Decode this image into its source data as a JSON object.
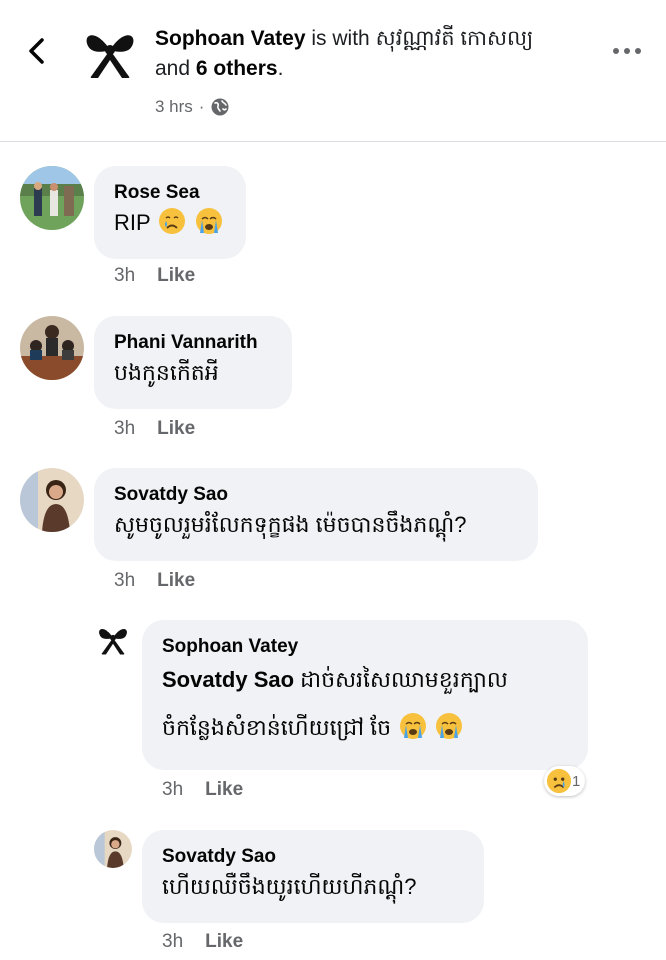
{
  "header": {
    "author": "Sophoan Vatey",
    "with_text": "is with",
    "tagged_person": "សុវណ្ណាវតី កោសល្យ",
    "and_text": "and",
    "others": "6 others",
    "period": ".",
    "time": "3 hrs",
    "separator": "·",
    "avatar_badge": "RIP"
  },
  "comments": [
    {
      "author": "Rose Sea",
      "text": "RIP",
      "time": "3h",
      "like": "Like"
    },
    {
      "author": "Phani Vannarith",
      "text": "បងកូនកើតអី",
      "time": "3h",
      "like": "Like"
    },
    {
      "author": "Sovatdy Sao",
      "text": "សូមចូលរួមរំលែកទុក្ខផង ម៉េចបានចឹងភណ្ដុំ?",
      "time": "3h",
      "like": "Like"
    }
  ],
  "replies": [
    {
      "author": "Sophoan Vatey",
      "avatar_badge": "RIP",
      "mention": "Sovatdy Sao",
      "text_line1": "ដាច់សរសៃឈាមខួរក្បាល",
      "text_line2": "ចំកន្លែងសំខាន់ហើយជ្រៅ ចែ",
      "time": "3h",
      "like": "Like",
      "reaction_count": "1"
    },
    {
      "author": "Sovatdy Sao",
      "text": "ហើយឈឺចឹងយូរហើយហីភណ្ដុំ?",
      "time": "3h",
      "like": "Like"
    }
  ]
}
